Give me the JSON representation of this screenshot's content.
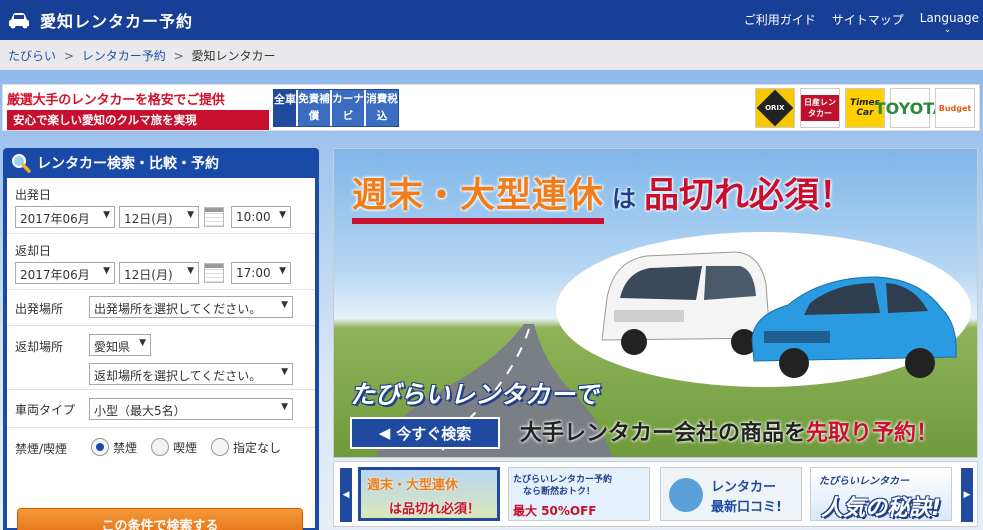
{
  "header": {
    "title": "愛知レンタカー予約",
    "nav": [
      "ご利用ガイド",
      "サイトマップ",
      "Language"
    ]
  },
  "breadcrumb": [
    "たびらい",
    "レンタカー予約",
    "愛知レンタカー"
  ],
  "promo": {
    "line1": "厳選大手のレンタカーを格安でご提供",
    "line2": "安心で楽しい愛知のクルマ旅を実現",
    "features_label": "全車",
    "features": [
      "免責補償",
      "カーナビ",
      "消費税込"
    ]
  },
  "logos": [
    {
      "name": "orix",
      "text": "ORIX"
    },
    {
      "name": "nissan",
      "text": "日産レンタカー"
    },
    {
      "name": "times",
      "text": "Times Car"
    },
    {
      "name": "toyota",
      "text": "TOYOTA"
    },
    {
      "name": "budget",
      "text": "Budget"
    }
  ],
  "search": {
    "title": "レンタカー検索・比較・予約",
    "depart_label": "出発日",
    "depart_month": "2017年06月",
    "depart_day": "12日(月)",
    "depart_time": "10:00",
    "return_label": "返却日",
    "return_month": "2017年06月",
    "return_day": "12日(月)",
    "return_time": "17:00",
    "depart_place_label": "出発場所",
    "depart_place": "出発場所を選択してください。",
    "return_place_label": "返却場所",
    "return_pref": "愛知県",
    "return_place": "返却場所を選択してください。",
    "vehicle_label": "車両タイプ",
    "vehicle": "小型（最大5名）",
    "smoking_label": "禁煙/喫煙",
    "smoking_options": [
      "禁煙",
      "喫煙",
      "指定なし"
    ],
    "submit": "この条件で検索する"
  },
  "hero": {
    "title_main": "週末・大型連休",
    "title_wa": "は",
    "title_sub": "品切れ必須！",
    "subtitle": "たびらいレンタカーで",
    "button": "今すぐ検索",
    "cta_1": "大手レンタカー会社の商品を",
    "cta_2": "先取り予約！"
  },
  "carousel": {
    "s1_a": "週末・大型連休",
    "s1_b": "は品切れ必須！",
    "s2_a": "たびらいレンタカー予約",
    "s2_b": "なら断然おトク！",
    "s2_c": "最大 50%OFF",
    "s3_a": "レンタカー",
    "s3_b": "最新口コミ!",
    "s4_a": "たびらいレンタカー",
    "s4_b": "人気の秘訣!"
  },
  "colors": {
    "brand": "#173f95",
    "accent": "#e66c10",
    "red": "#c8102e"
  }
}
